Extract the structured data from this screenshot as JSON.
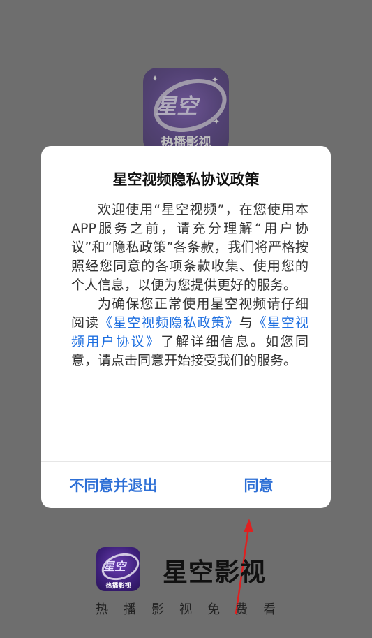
{
  "background_icon": {
    "logo_text": "星空",
    "sub_text": "热播影视"
  },
  "dialog": {
    "title": "星空视频隐私协议政策",
    "paragraph1": "欢迎使用“星空视频”，在您使用本APP服务之前，请充分理解“用户协议”和“隐私政策”各条款，我们将严格按照经您同意的各项条款收集、使用您的个人信息，以便为您提供更好的服务。",
    "paragraph2_prefix": "为确保您正常使用星空视频请仔细阅读",
    "privacy_link": "《星空视频隐私政策》",
    "paragraph2_and": "与",
    "user_agreement_link": "《星空视频用户协议》",
    "paragraph2_suffix": "了解详细信息。如您同意，请点击同意开始接受我们的服务。",
    "decline_button": "不同意并退出",
    "agree_button": "同意"
  },
  "splash": {
    "icon_logo_text": "星空",
    "icon_sub_text": "热播影视",
    "brand_name": "星空影视",
    "slogan": "热播影视免费看"
  },
  "colors": {
    "overlay": "#6e6e6e",
    "link": "#1e6fe0",
    "button_text": "#2d6fd6",
    "annotation_arrow": "#e02020"
  }
}
